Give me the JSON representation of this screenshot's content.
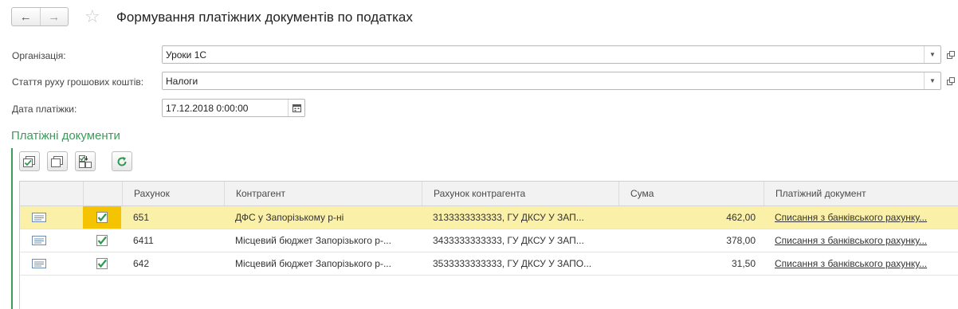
{
  "header": {
    "title": "Формування платіжних документів по податках",
    "back_icon": "←",
    "forward_icon": "→",
    "star_icon": "☆"
  },
  "form": {
    "org_label": "Організація:",
    "org_value": "Уроки 1С",
    "cashflow_label": "Стаття руху грошових коштів:",
    "cashflow_value": "Налоги",
    "date_label": "Дата платіжки:",
    "date_value": "17.12.2018  0:00:00"
  },
  "section": {
    "title": "Платіжні документи"
  },
  "table": {
    "columns": [
      "Рахунок",
      "Контрагент",
      "Рахунок контрагента",
      "Сума",
      "Платіжний документ"
    ],
    "rows": [
      {
        "account": "651",
        "counterparty": "ДФС у Запорізькому р-ні",
        "cp_account": "3133333333333, ГУ ДКСУ У ЗАП...",
        "sum": "462,00",
        "document": "Списання з банківського рахунку...",
        "checked": true,
        "selected": true
      },
      {
        "account": "6411",
        "counterparty": "Місцевий бюджет Запорізького р-...",
        "cp_account": "3433333333333, ГУ ДКСУ У ЗАП...",
        "sum": "378,00",
        "document": "Списання з банківського рахунку...",
        "checked": true,
        "selected": false
      },
      {
        "account": "642",
        "counterparty": "Місцевий бюджет Запорізького р-...",
        "cp_account": "3533333333333, ГУ ДКСУ У ЗАПО...",
        "sum": "31,50",
        "document": "Списання з банківського рахунку...",
        "checked": true,
        "selected": false
      }
    ]
  },
  "colors": {
    "accent": "#3d9b5b",
    "selected_row": "#fbf0a8",
    "selected_check": "#f5c400"
  }
}
